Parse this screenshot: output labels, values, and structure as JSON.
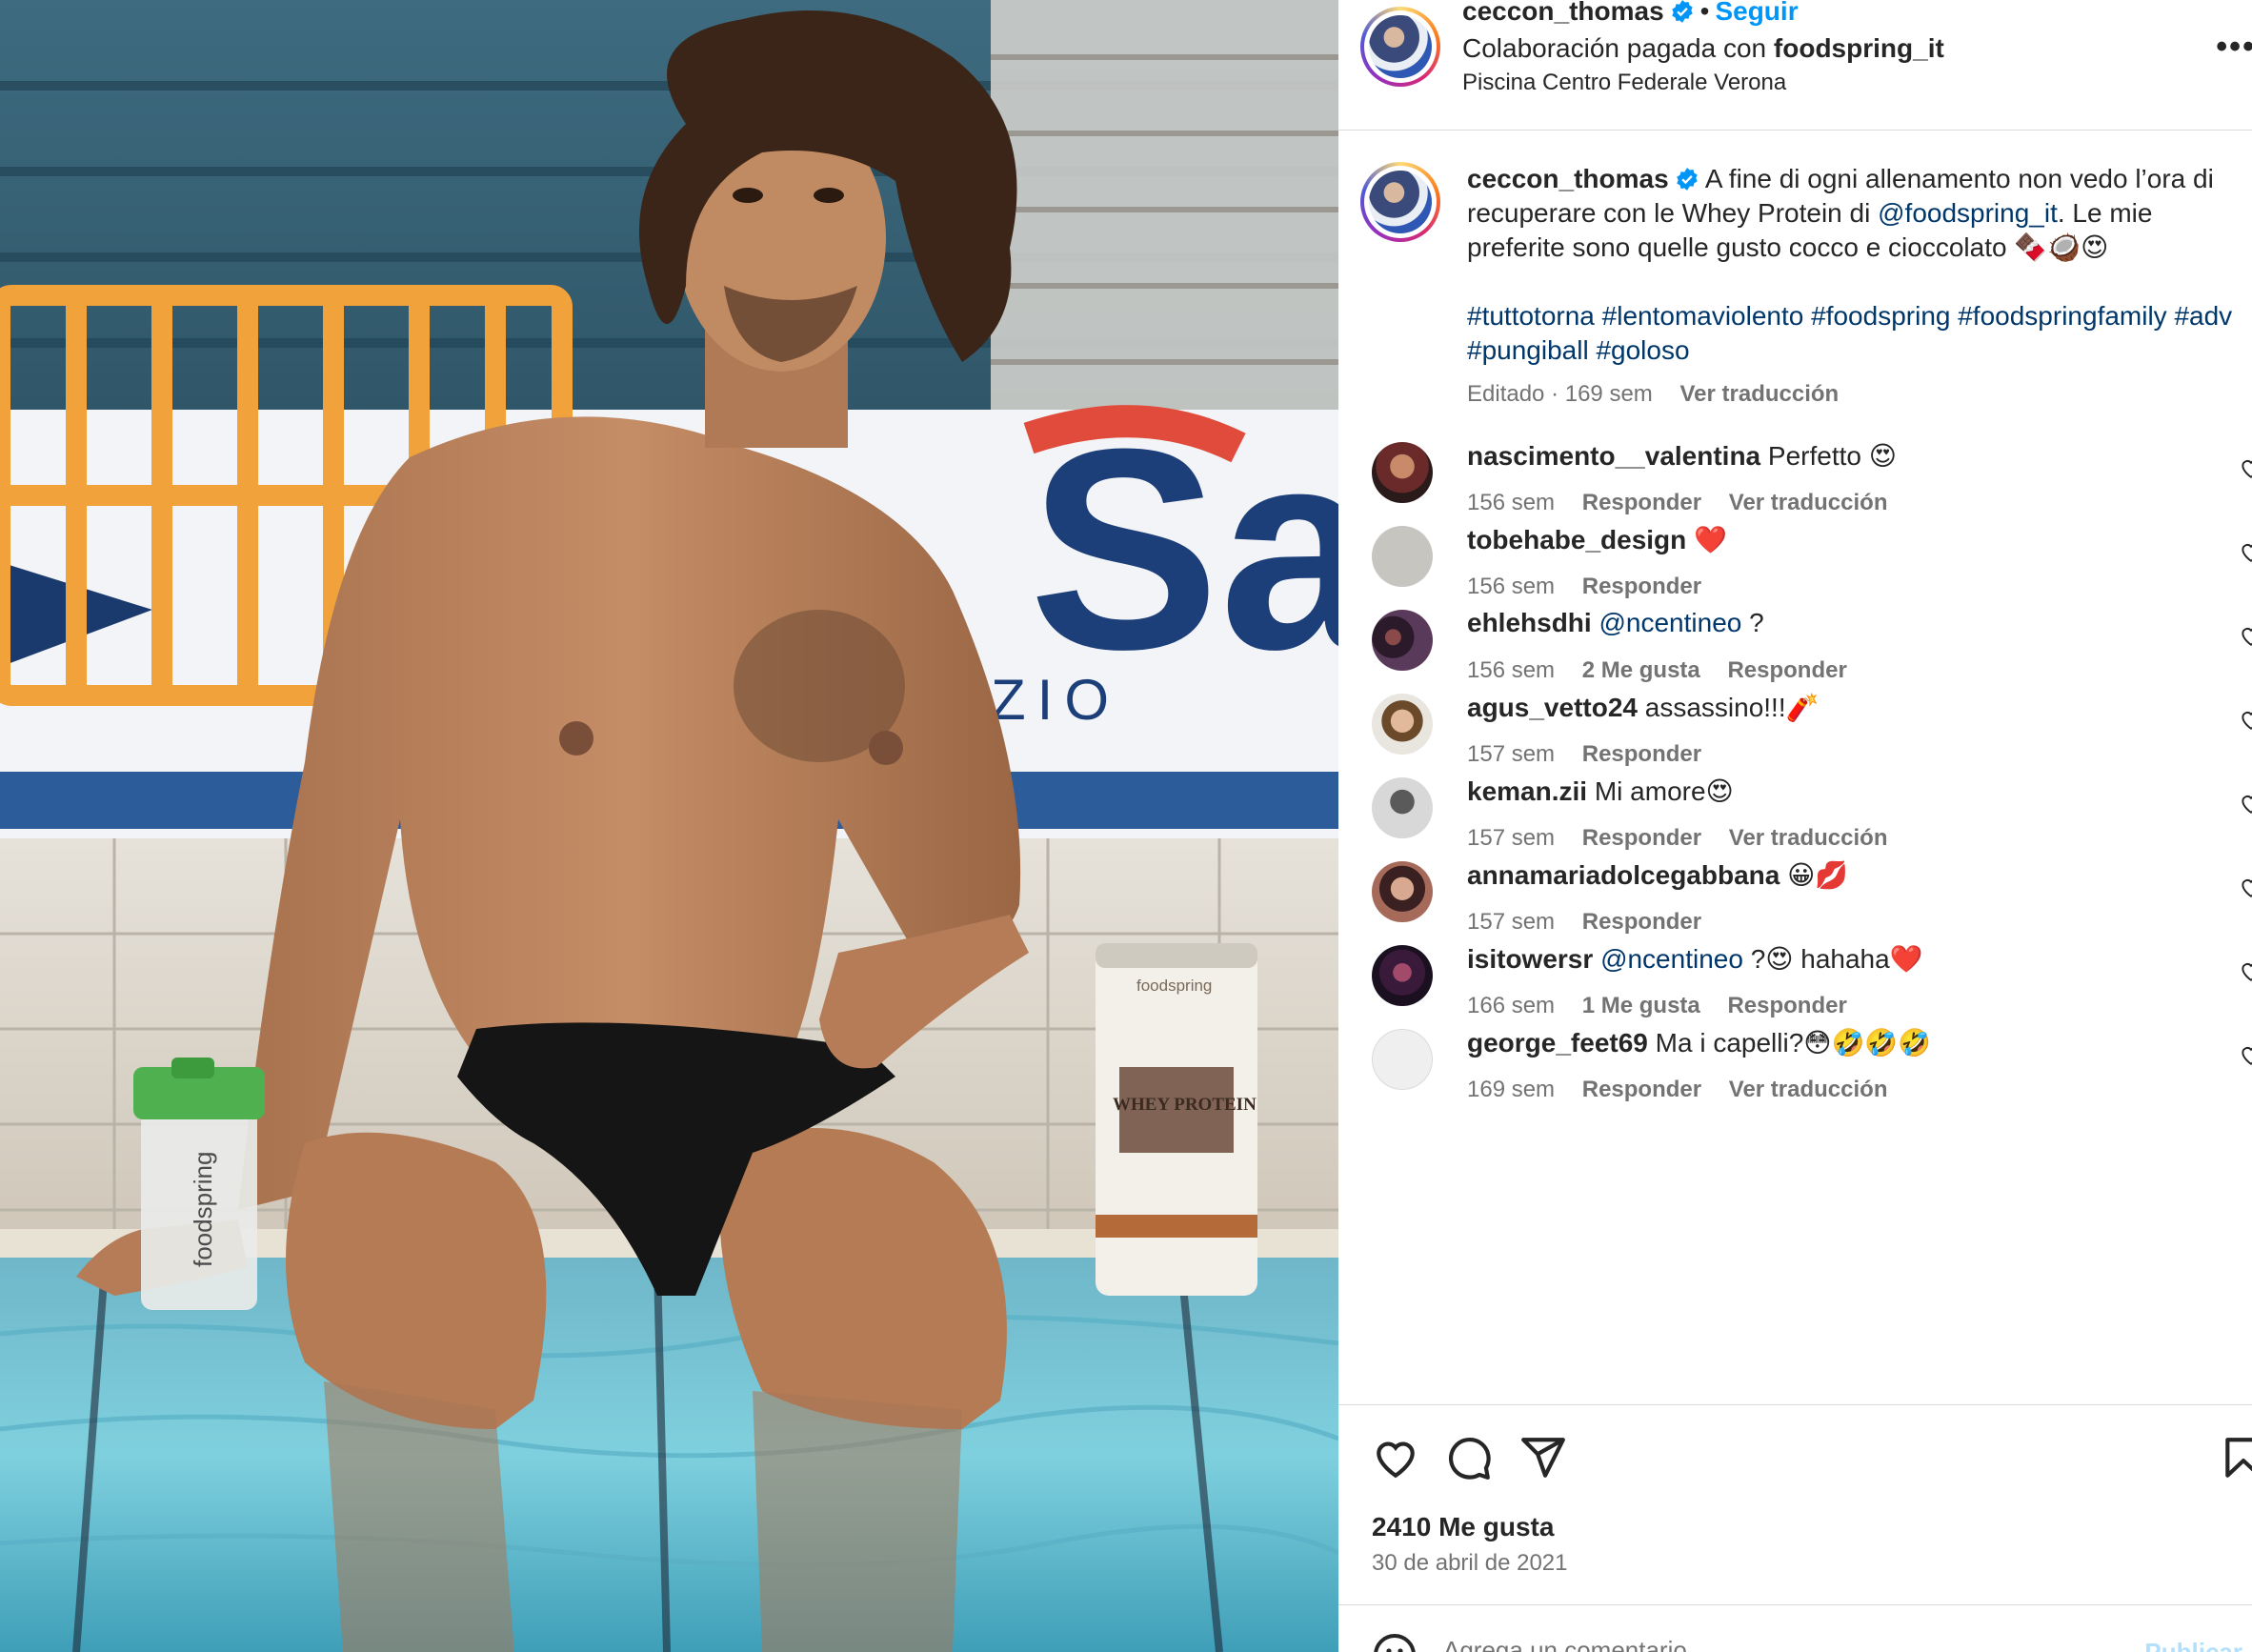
{
  "post": {
    "username": "ceccon_thomas",
    "dot": "•",
    "follow_label": "Seguir",
    "collab_prefix": "Colaboración pagada con",
    "collab_brand": "foodspring_it",
    "location": "Piscina Centro Federale Verona",
    "more_label": "•••"
  },
  "caption": {
    "username": "ceccon_thomas",
    "text_before_mention": "A fine di ogni allenamento non vedo l’ora di recuperare con le Whey Protein di",
    "mention": "@foodspring_it",
    "text_after_mention": ". Le mie preferite sono quelle gusto cocco e cioccolato",
    "hashtags": "#tuttotorna #lentomaviolento #foodspring #foodspringfamily #adv #pungiball #goloso",
    "edited": "Editado",
    "time": "169 sem",
    "translate": "Ver traducción"
  },
  "photo": {
    "shaker_brand": "foodspring",
    "tub_brand": "foodspring",
    "tub_label": "WHEY PROTEIN",
    "banner_letters": "Sa",
    "banner_sub": "ZIO"
  },
  "comments": [
    {
      "user": "nascimento__valentina",
      "text": "Perfetto",
      "emoji": "😍",
      "time": "156 sem",
      "likes": "",
      "reply": "Responder",
      "translate": "Ver traducción"
    },
    {
      "user": "tobehabe_design",
      "text": "",
      "emoji": "❤️",
      "time": "156 sem",
      "likes": "",
      "reply": "Responder",
      "translate": ""
    },
    {
      "user": "ehlehsdhi",
      "mention": "@ncentineo",
      "text": "?",
      "emoji": "",
      "time": "156 sem",
      "likes": "2 Me gusta",
      "reply": "Responder",
      "translate": ""
    },
    {
      "user": "agus_vetto24",
      "text": "assassino!!!",
      "emoji": "🧨",
      "time": "157 sem",
      "likes": "",
      "reply": "Responder",
      "translate": ""
    },
    {
      "user": "keman.zii",
      "text": "Mi amore",
      "emoji": "😍",
      "time": "157 sem",
      "likes": "",
      "reply": "Responder",
      "translate": "Ver traducción"
    },
    {
      "user": "annamariadolcegabbana",
      "text": "",
      "emoji": "😀💋",
      "time": "157 sem",
      "likes": "",
      "reply": "Responder",
      "translate": ""
    },
    {
      "user": "isitowersr",
      "mention": "@ncentineo",
      "text": "?",
      "emoji": "😍",
      "text_after": "hahaha",
      "emoji_after": "❤️",
      "time": "166 sem",
      "likes": "1 Me gusta",
      "reply": "Responder",
      "translate": ""
    },
    {
      "user": "george_feet69",
      "text": "Ma i capelli?",
      "emoji": "😳🤣🤣🤣",
      "time": "169 sem",
      "likes": "",
      "reply": "Responder",
      "translate": "Ver traducción"
    }
  ],
  "footer": {
    "likes": "2410 Me gusta",
    "date": "30 de abril de 2021",
    "comment_placeholder": "Agrega un comentario...",
    "publish_label": "Publicar"
  },
  "colors": {
    "accent": "#0095f6",
    "link": "#00376b",
    "muted": "#737373",
    "divider": "#dbdbdb",
    "publish_disabled": "#b2dffc"
  }
}
